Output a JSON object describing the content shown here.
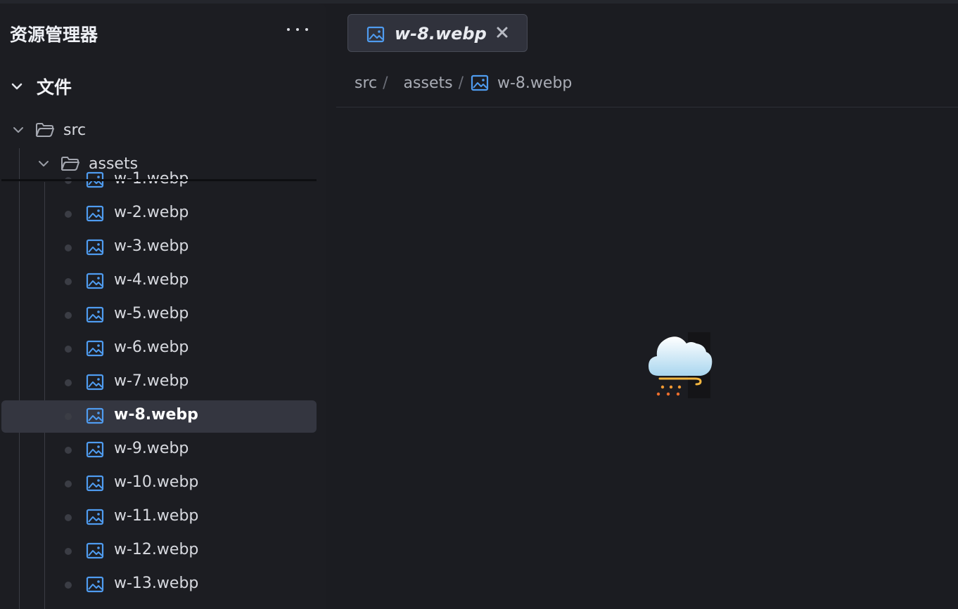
{
  "explorer": {
    "title": "资源管理器",
    "more_icon": "ellipsis-icon",
    "section_label": "文件",
    "folders": {
      "src": "src",
      "assets": "assets"
    },
    "files": [
      {
        "label": "w-1.webp"
      },
      {
        "label": "w-2.webp"
      },
      {
        "label": "w-3.webp"
      },
      {
        "label": "w-4.webp"
      },
      {
        "label": "w-5.webp"
      },
      {
        "label": "w-6.webp"
      },
      {
        "label": "w-7.webp"
      },
      {
        "label": "w-8.webp",
        "active": true
      },
      {
        "label": "w-9.webp"
      },
      {
        "label": "w-10.webp"
      },
      {
        "label": "w-11.webp"
      },
      {
        "label": "w-12.webp"
      },
      {
        "label": "w-13.webp"
      }
    ]
  },
  "editor": {
    "tab": {
      "label": "w-8.webp",
      "icon": "image-file-icon"
    },
    "breadcrumb": {
      "src": "src",
      "assets": "assets",
      "file": "w-8.webp",
      "separator": "/"
    },
    "preview_icon": "cloud-snow-wind-icon"
  },
  "colors": {
    "background": "#1b1c21",
    "sidebar": "#1c1d22",
    "active_row": "#343640",
    "image_icon": "#4f9cf0",
    "text": "#d8dae0"
  }
}
